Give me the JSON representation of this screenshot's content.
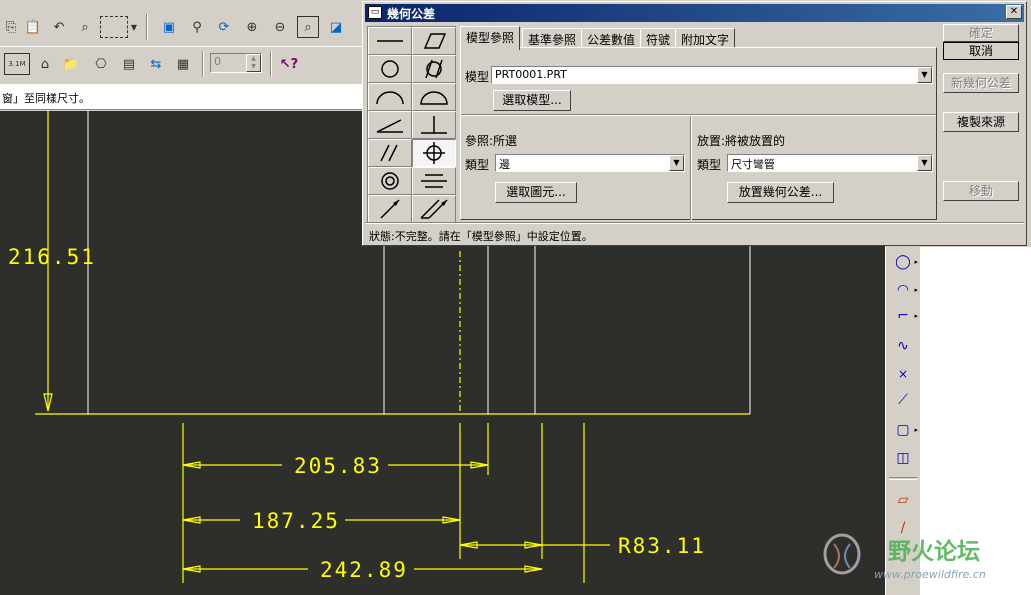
{
  "dialog": {
    "title": "幾何公差",
    "close_glyph": "✕",
    "tabs": [
      {
        "label": "模型參照"
      },
      {
        "label": "基準參照"
      },
      {
        "label": "公差數值"
      },
      {
        "label": "符號"
      },
      {
        "label": "附加文字"
      }
    ],
    "model_label": "模型",
    "model_value": "PRT0001.PRT",
    "select_model_button": "選取模型...",
    "reference": {
      "heading": "參照:所選",
      "type_label": "類型",
      "type_value": "邊",
      "select_button": "選取圖元..."
    },
    "placement": {
      "heading": "放置:將被放置的",
      "type_label": "類型",
      "type_value": "尺寸彎管",
      "place_button": "放置幾何公差..."
    },
    "side_buttons": {
      "ok": "確定",
      "cancel": "取消",
      "new": "新幾何公差",
      "copy": "複製來源",
      "move": "移動"
    },
    "status": "狀態:不完整。請在「模型參照」中設定位置。",
    "palette": [
      {
        "icon": "straightness-icon"
      },
      {
        "icon": "flatness-icon"
      },
      {
        "icon": "circularity-icon"
      },
      {
        "icon": "cylindricity-icon"
      },
      {
        "icon": "line-profile-icon"
      },
      {
        "icon": "surface-profile-icon"
      },
      {
        "icon": "angularity-icon"
      },
      {
        "icon": "perpendicularity-icon"
      },
      {
        "icon": "parallelism-icon"
      },
      {
        "icon": "position-icon"
      },
      {
        "icon": "concentricity-icon"
      },
      {
        "icon": "symmetry-icon"
      },
      {
        "icon": "circular-runout-icon"
      },
      {
        "icon": "total-runout-icon"
      }
    ]
  },
  "app": {
    "status_line": "窗」至同樣尺寸。",
    "spin_value": "0"
  },
  "drawing": {
    "dims": {
      "d1": "216.51",
      "d2": "205.83",
      "d3": "187.25",
      "d4": "242.89",
      "d5": "R83.11"
    },
    "line_color": "#ffff00",
    "bg_color": "#2e2e2a"
  },
  "watermark": {
    "name": "野火论坛",
    "url": "www.proewildfire.cn"
  }
}
